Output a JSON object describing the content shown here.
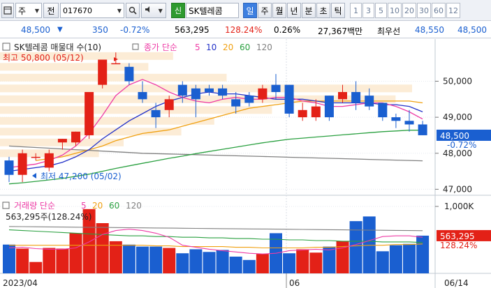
{
  "toolbar": {
    "menu_icon": "window-icon",
    "market": "주",
    "code_label": "전",
    "code": "017670",
    "search_icon": "magnifier-icon",
    "sound_icon": "speaker-icon",
    "new_badge": "신",
    "stock_name": "SK텔레콤",
    "periods": [
      "일",
      "주",
      "월",
      "년",
      "분",
      "초",
      "틱"
    ],
    "selected_period": "일",
    "intervals": [
      "1",
      "3",
      "5",
      "10",
      "20",
      "30",
      "60",
      "12"
    ]
  },
  "quote": {
    "price": "48,500",
    "change": "350",
    "change_pct": "-0.72%",
    "volume": "563,295",
    "volume_ratio": "128.24%",
    "turnover": "0.26%",
    "amount": "27,367백만",
    "best_label": "최우선",
    "best_ask": "48,550",
    "best_bid": "48,500"
  },
  "colors": {
    "up": "#e32117",
    "down": "#1a5fd0",
    "ma5": "#ee3ba5",
    "ma10": "#2231c8",
    "ma20": "#f0a010",
    "ma60": "#2aa040",
    "ma120": "#808080"
  },
  "price_panel": {
    "title": "SK텔레콤 매물대 수(10)",
    "close_label": "종가",
    "ma_label": "단순",
    "ma_periods": [
      "5",
      "10",
      "20",
      "60",
      "120"
    ],
    "high_label": "최고 50,800 (05/12)",
    "low_label": "최저 47,200 (05/02)",
    "axis_labels": [
      "50,000",
      "49,000",
      "48,000",
      "47,000"
    ],
    "current_price": "48,500",
    "current_change": "-0.72%"
  },
  "volume_panel": {
    "title": "거래량",
    "ma_label": "단순",
    "ma_periods": [
      "5",
      "20",
      "60",
      "120"
    ],
    "value_label": "563,295주(128.24%)",
    "axis_label": "1,000K",
    "current_volume": "563,295",
    "current_ratio": "128.24%"
  },
  "date_axis": {
    "labels": [
      "2023/04",
      "06",
      "06/14"
    ]
  },
  "chart_data": {
    "type": "candlestick",
    "ylim": [
      46950,
      50900
    ],
    "volume_max": 1000000,
    "candles": [
      {
        "o": 47800,
        "h": 47900,
        "l": 47200,
        "c": 47400,
        "v": 430000
      },
      {
        "o": 47400,
        "h": 48100,
        "l": 47200,
        "c": 48000,
        "v": 370000
      },
      {
        "o": 47900,
        "h": 48000,
        "l": 47800,
        "c": 47900,
        "v": 170000
      },
      {
        "o": 47600,
        "h": 48100,
        "l": 47500,
        "c": 48000,
        "v": 380000
      },
      {
        "o": 48300,
        "h": 48400,
        "l": 48100,
        "c": 48400,
        "v": 370000
      },
      {
        "o": 48300,
        "h": 48600,
        "l": 48200,
        "c": 48600,
        "v": 600000
      },
      {
        "o": 48500,
        "h": 49700,
        "l": 48400,
        "c": 49700,
        "v": 960000
      },
      {
        "o": 49900,
        "h": 50600,
        "l": 49800,
        "c": 50600,
        "v": 750000
      },
      {
        "o": 50500,
        "h": 50800,
        "l": 50500,
        "c": 50500,
        "v": 480000
      },
      {
        "o": 50400,
        "h": 50500,
        "l": 49900,
        "c": 50000,
        "v": 430000
      },
      {
        "o": 49700,
        "h": 50000,
        "l": 49400,
        "c": 49500,
        "v": 400000
      },
      {
        "o": 49200,
        "h": 49400,
        "l": 48700,
        "c": 49000,
        "v": 400000
      },
      {
        "o": 49200,
        "h": 49600,
        "l": 49000,
        "c": 49500,
        "v": 380000
      },
      {
        "o": 49900,
        "h": 50000,
        "l": 49400,
        "c": 49600,
        "v": 300000
      },
      {
        "o": 49800,
        "h": 49900,
        "l": 49000,
        "c": 49500,
        "v": 360000
      },
      {
        "o": 49800,
        "h": 49900,
        "l": 49600,
        "c": 49700,
        "v": 320000
      },
      {
        "o": 49800,
        "h": 49900,
        "l": 49500,
        "c": 49600,
        "v": 350000
      },
      {
        "o": 49500,
        "h": 49700,
        "l": 49100,
        "c": 49300,
        "v": 250000
      },
      {
        "o": 49600,
        "h": 49700,
        "l": 49300,
        "c": 49400,
        "v": 200000
      },
      {
        "o": 49500,
        "h": 49900,
        "l": 49400,
        "c": 49800,
        "v": 290000
      },
      {
        "o": 49900,
        "h": 50200,
        "l": 49500,
        "c": 49700,
        "v": 600000
      },
      {
        "o": 49900,
        "h": 49900,
        "l": 49000,
        "c": 49100,
        "v": 300000
      },
      {
        "o": 49000,
        "h": 49400,
        "l": 48900,
        "c": 49200,
        "v": 360000
      },
      {
        "o": 49000,
        "h": 49500,
        "l": 48900,
        "c": 49300,
        "v": 310000
      },
      {
        "o": 49600,
        "h": 49600,
        "l": 48900,
        "c": 49000,
        "v": 400000
      },
      {
        "o": 49500,
        "h": 49900,
        "l": 49400,
        "c": 49700,
        "v": 480000
      },
      {
        "o": 49700,
        "h": 50000,
        "l": 49200,
        "c": 49400,
        "v": 780000
      },
      {
        "o": 49600,
        "h": 49800,
        "l": 49200,
        "c": 49300,
        "v": 850000
      },
      {
        "o": 49400,
        "h": 49400,
        "l": 48900,
        "c": 49000,
        "v": 330000
      },
      {
        "o": 49000,
        "h": 49100,
        "l": 48700,
        "c": 48900,
        "v": 420000
      },
      {
        "o": 48900,
        "h": 49200,
        "l": 48600,
        "c": 48800,
        "v": 440000
      },
      {
        "o": 48800,
        "h": 48900,
        "l": 48500,
        "c": 48500,
        "v": 563295
      }
    ],
    "ma5": [
      47600,
      47650,
      47700,
      47800,
      47950,
      48200,
      48550,
      49050,
      49600,
      49900,
      50050,
      49900,
      49700,
      49550,
      49450,
      49400,
      49500,
      49550,
      49500,
      49500,
      49550,
      49550,
      49450,
      49400,
      49300,
      49300,
      49350,
      49400,
      49400,
      49300,
      49150,
      48950
    ],
    "ma10": [
      47500,
      47550,
      47600,
      47650,
      47750,
      47900,
      48100,
      48400,
      48650,
      48900,
      49100,
      49300,
      49450,
      49550,
      49650,
      49700,
      49650,
      49650,
      49600,
      49550,
      49500,
      49500,
      49500,
      49450,
      49400,
      49400,
      49400,
      49400,
      49350,
      49350,
      49300,
      49150
    ],
    "ma20": [
      null,
      null,
      47800,
      47850,
      47900,
      48000,
      48100,
      48200,
      48350,
      48450,
      48550,
      48600,
      48650,
      48750,
      48850,
      48950,
      49050,
      49150,
      49250,
      49300,
      49350,
      49400,
      49450,
      49450,
      49450,
      49450,
      49450,
      49450,
      49450,
      49450,
      49450,
      49400
    ],
    "ma60": [
      47150,
      47180,
      47220,
      47260,
      47300,
      47360,
      47420,
      47500,
      47580,
      47650,
      47720,
      47790,
      47860,
      47920,
      47990,
      48050,
      48110,
      48170,
      48230,
      48290,
      48340,
      48390,
      48420,
      48450,
      48480,
      48510,
      48540,
      48570,
      48600,
      48620,
      48640,
      48640
    ],
    "ma120": [
      48200,
      48180,
      48160,
      48140,
      48120,
      48100,
      48080,
      48060,
      48040,
      48020,
      48000,
      47990,
      47980,
      47970,
      47960,
      47950,
      47940,
      47930,
      47920,
      47910,
      47900,
      47890,
      47880,
      47870,
      47860,
      47850,
      47840,
      47830,
      47820,
      47810,
      47800,
      47790
    ],
    "vol_ma5": [
      380000,
      390000,
      370000,
      360000,
      360000,
      380000,
      470000,
      580000,
      640000,
      660000,
      640000,
      600000,
      540000,
      420000,
      390000,
      360000,
      340000,
      320000,
      300000,
      290000,
      300000,
      340000,
      350000,
      360000,
      350000,
      380000,
      430000,
      490000,
      550000,
      560000,
      560000,
      540000
    ],
    "vol_ma20": [
      420000,
      420000,
      420000,
      420000,
      420000,
      420000,
      420000,
      420000,
      420000,
      420000,
      420000,
      410000,
      410000,
      400000,
      400000,
      400000,
      400000,
      390000,
      390000,
      380000,
      380000,
      380000,
      380000,
      390000,
      390000,
      400000,
      410000,
      420000,
      420000,
      430000,
      430000,
      440000
    ],
    "vol_ma60": [
      650000,
      640000,
      630000,
      620000,
      610000,
      600000,
      590000,
      580000,
      570000,
      560000,
      560000,
      550000,
      550000,
      540000,
      540000,
      530000,
      530000,
      520000,
      520000,
      510000,
      510000,
      500000,
      500000,
      490000,
      490000,
      480000,
      480000,
      480000,
      470000,
      470000,
      470000,
      460000
    ],
    "vol_ma120": [
      700000,
      698000,
      696000,
      694000,
      692000,
      690000,
      688000,
      686000,
      684000,
      682000,
      680000,
      678000,
      676000,
      674000,
      672000,
      670000,
      668000,
      666000,
      664000,
      662000,
      660000,
      658000,
      656000,
      654000,
      652000,
      650000,
      648000,
      646000,
      644000,
      642000,
      640000,
      638000
    ],
    "volume_profile": [
      {
        "price": 50700,
        "v": 0.42
      },
      {
        "price": 50400,
        "v": 0.36
      },
      {
        "price": 50100,
        "v": 0.55
      },
      {
        "price": 49800,
        "v": 1.0
      },
      {
        "price": 49500,
        "v": 0.96
      },
      {
        "price": 49200,
        "v": 0.66
      },
      {
        "price": 48900,
        "v": 0.52
      },
      {
        "price": 48600,
        "v": 0.44
      },
      {
        "price": 48300,
        "v": 0.3
      },
      {
        "price": 48000,
        "v": 0.24
      }
    ]
  }
}
